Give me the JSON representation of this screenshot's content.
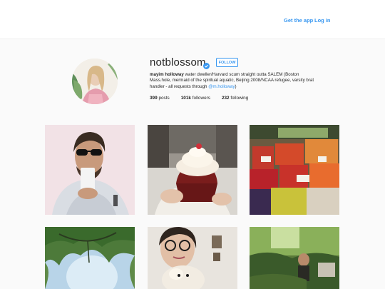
{
  "header": {
    "get_app_label": "Get the app",
    "login_label": "Log in"
  },
  "profile": {
    "username": "notblossom",
    "follow_label": "FOLLOW",
    "full_name": "mayim holloway",
    "bio_text": "water dweller/Harvard scum straight outta SALEM (Boston Mass.hole, mermaid of the spiritual aquatic, Beijing 2008/NCAA refugee, varsity brat handler - all requests through ",
    "bio_mention": "@m.holloway",
    "bio_end": ")",
    "posts_count": "399",
    "posts_label": "posts",
    "followers_count": "101k",
    "followers_label": "followers",
    "following_count": "232",
    "following_label": "following"
  },
  "colors": {
    "accent": "#3897f0",
    "text": "#262626",
    "background": "#fafafa"
  },
  "posts": [
    {
      "subject": "man-with-sunglasses-drinking"
    },
    {
      "subject": "red-velvet-cupcake"
    },
    {
      "subject": "fruit-market-stand"
    },
    {
      "subject": "tree-canopy-sky"
    },
    {
      "subject": "woman-with-glasses-and-dog"
    },
    {
      "subject": "person-in-garden"
    }
  ]
}
